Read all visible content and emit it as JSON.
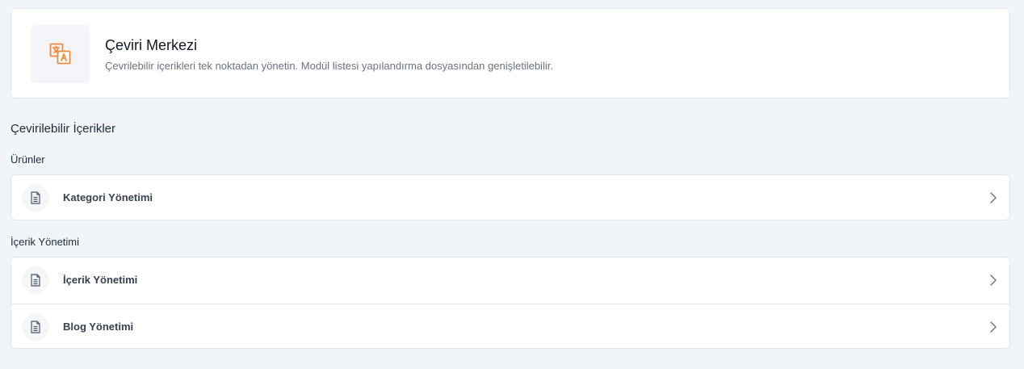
{
  "header": {
    "title": "Çeviri Merkezi",
    "subtitle": "Çevrilebilir içerikleri tek noktadan yönetin. Modül listesi yapılandırma dosyasından genişletilebilir.",
    "icon": "translate-icon",
    "accent_color": "#f08a3c"
  },
  "section": {
    "title": "Çevirilebilir İçerikler"
  },
  "groups": [
    {
      "label": "Ürünler",
      "items": [
        {
          "label": "Kategori Yönetimi",
          "icon": "document-icon"
        }
      ]
    },
    {
      "label": "İçerik Yönetimi",
      "items": [
        {
          "label": "İçerik Yönetimi",
          "icon": "document-icon"
        },
        {
          "label": "Blog Yönetimi",
          "icon": "document-icon"
        }
      ]
    }
  ]
}
